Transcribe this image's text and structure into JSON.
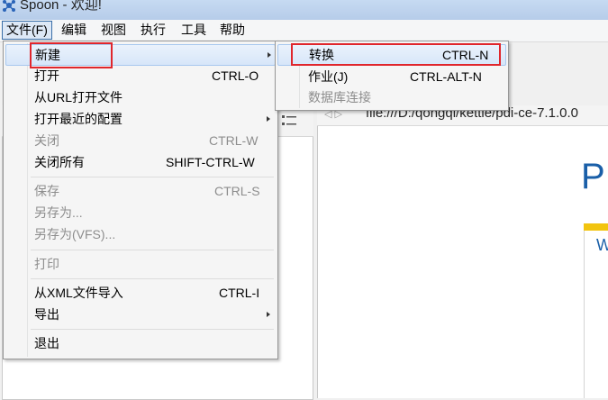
{
  "window": {
    "title": "Spoon - 欢迎!"
  },
  "menubar": [
    "文件(F)",
    "编辑",
    "视图",
    "执行",
    "工具",
    "帮助"
  ],
  "file_menu": {
    "items": [
      {
        "label": "新建",
        "shortcut": "",
        "submenu": true,
        "disabled": false
      },
      {
        "label": "打开",
        "shortcut": "CTRL-O",
        "submenu": false,
        "disabled": false
      },
      {
        "label": "从URL打开文件",
        "shortcut": "",
        "submenu": false,
        "disabled": false
      },
      {
        "label": "打开最近的配置",
        "shortcut": "",
        "submenu": true,
        "disabled": false
      },
      {
        "label": "关闭",
        "shortcut": "CTRL-W",
        "submenu": false,
        "disabled": true
      },
      {
        "label": "关闭所有",
        "shortcut": "SHIFT-CTRL-W",
        "submenu": false,
        "disabled": false
      },
      {
        "label": "保存",
        "shortcut": "CTRL-S",
        "submenu": false,
        "disabled": true
      },
      {
        "label": "另存为...",
        "shortcut": "",
        "submenu": false,
        "disabled": true
      },
      {
        "label": "另存为(VFS)...",
        "shortcut": "",
        "submenu": false,
        "disabled": true
      },
      {
        "label": "打印",
        "shortcut": "",
        "submenu": false,
        "disabled": true
      },
      {
        "label": "从XML文件导入",
        "shortcut": "CTRL-I",
        "submenu": false,
        "disabled": false
      },
      {
        "label": "导出",
        "shortcut": "",
        "submenu": true,
        "disabled": false
      },
      {
        "label": "退出",
        "shortcut": "",
        "submenu": false,
        "disabled": false
      }
    ]
  },
  "new_submenu": {
    "items": [
      {
        "label": "转换",
        "shortcut": "CTRL-N",
        "disabled": false
      },
      {
        "label": "作业(J)",
        "shortcut": "CTRL-ALT-N",
        "disabled": false
      },
      {
        "label": "数据库连接",
        "shortcut": "",
        "disabled": true
      }
    ]
  },
  "browser": {
    "url": "file:///D:/qongqi/kettle/pdi-ce-7.1.0.0",
    "heading_letter": "P",
    "side_letter": "W"
  },
  "colors": {
    "highlight_box": "#e0262c",
    "accent": "#1a5fa8",
    "yellow": "#f2c40f"
  }
}
